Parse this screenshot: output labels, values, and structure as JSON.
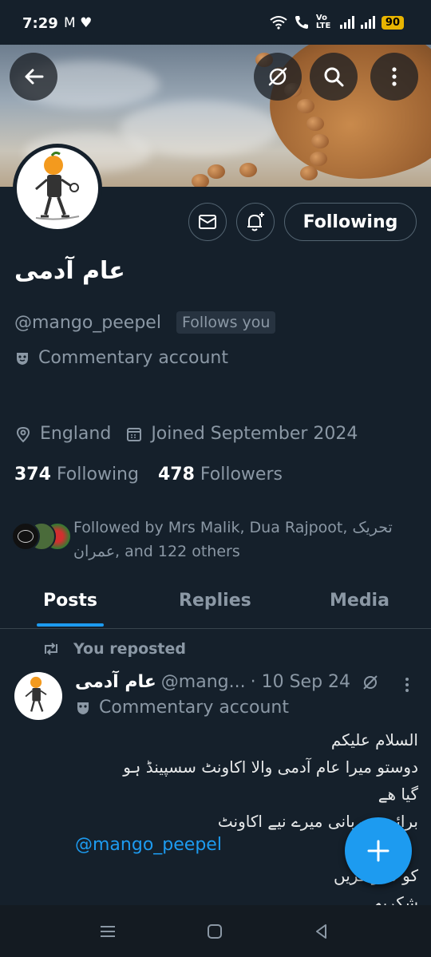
{
  "status_bar": {
    "time": "7:29",
    "left_icons": [
      "gmail-icon",
      "heart-icon"
    ],
    "right_icons": [
      "wifi-icon",
      "call-icon",
      "volte-icon",
      "signal-icon",
      "signal-icon"
    ],
    "volte_label": "Vo LTE",
    "battery": "90"
  },
  "header": {
    "back_icon": "arrow-left-icon",
    "actions": [
      "no-sync-icon",
      "search-icon",
      "more-vertical-icon"
    ]
  },
  "profile": {
    "display_name": "عام آدمی",
    "handle": "@mango_peepel",
    "follows_you": "Follows you",
    "label": "Commentary account",
    "location": "England",
    "joined": "Joined September 2024",
    "following_count": "374",
    "following_label": "Following",
    "followers_count": "478",
    "followers_label": "Followers",
    "followed_by": "Followed by Mrs Malik, Dua Rajpoot, تحریک عمران, and 122 others",
    "buttons": {
      "message_icon": "mail-icon",
      "notify_icon": "bell-plus-icon",
      "following": "Following"
    }
  },
  "tabs": [
    {
      "label": "Posts",
      "active": true
    },
    {
      "label": "Replies",
      "active": false
    },
    {
      "label": "Media",
      "active": false
    }
  ],
  "tweet": {
    "repost_label": "You reposted",
    "name": "عام آدمی",
    "handle": "@mang...",
    "date": "· 10 Sep 24",
    "label": "Commentary account",
    "body_lines": [
      "السلام علیکم",
      "دوستو میرا عام آدمی والا اکاونٹ سسپینڈ ہو",
      "گیا ھے",
      "برائے مہربانی میرے نیے اکاونٹ",
      "",
      "کو فالو کریں",
      "شکریہ"
    ],
    "mention": "@mango_peepel"
  },
  "fab_icon": "plus-icon",
  "nav": [
    "recents-icon",
    "home-icon",
    "back-icon"
  ]
}
